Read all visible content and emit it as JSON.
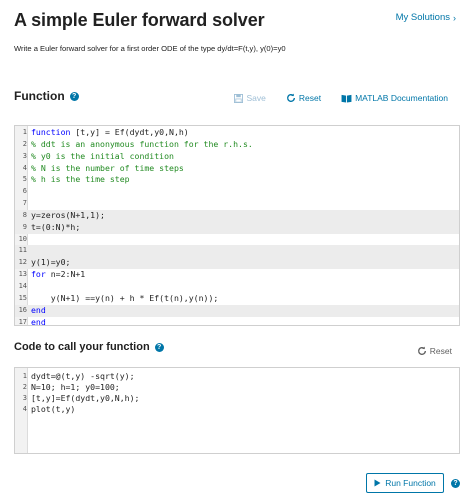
{
  "header": {
    "title": "A simple Euler forward solver",
    "my_solutions": "My Solutions",
    "description": "Write a Euler forward solver for a first order ODE of the type dy/dt=F(t,y), y(0)=y0"
  },
  "function_section": {
    "title": "Function",
    "save_label": "Save",
    "reset_label": "Reset",
    "docs_label": "MATLAB Documentation",
    "lines": [
      {
        "n": "1",
        "segments": [
          {
            "t": "function",
            "c": "kw"
          },
          {
            "t": " [t,y] = Ef(dydt,y0,N,h)",
            "c": ""
          }
        ],
        "shaded": false
      },
      {
        "n": "2",
        "segments": [
          {
            "t": "% ddt is an anonymous function for the r.h.s.",
            "c": "cm"
          }
        ],
        "shaded": false
      },
      {
        "n": "3",
        "segments": [
          {
            "t": "% y0 is the initial condition",
            "c": "cm"
          }
        ],
        "shaded": false
      },
      {
        "n": "4",
        "segments": [
          {
            "t": "% N is the number of time steps",
            "c": "cm"
          }
        ],
        "shaded": false
      },
      {
        "n": "5",
        "segments": [
          {
            "t": "% h is the time step",
            "c": "cm"
          }
        ],
        "shaded": false
      },
      {
        "n": "6",
        "segments": [],
        "shaded": false
      },
      {
        "n": "7",
        "segments": [],
        "shaded": false
      },
      {
        "n": "8",
        "segments": [
          {
            "t": "y=zeros(N+1,1);",
            "c": ""
          }
        ],
        "shaded": true
      },
      {
        "n": "9",
        "segments": [
          {
            "t": "t=(0:N)*h;",
            "c": ""
          }
        ],
        "shaded": true
      },
      {
        "n": "10",
        "segments": [],
        "shaded": false
      },
      {
        "n": "11",
        "segments": [],
        "shaded": true
      },
      {
        "n": "12",
        "segments": [
          {
            "t": "y(1)=y0;",
            "c": ""
          }
        ],
        "shaded": true
      },
      {
        "n": "13",
        "segments": [
          {
            "t": "for",
            "c": "kw"
          },
          {
            "t": " n=2:N+1",
            "c": ""
          }
        ],
        "shaded": false
      },
      {
        "n": "14",
        "segments": [],
        "shaded": false
      },
      {
        "n": "15",
        "segments": [
          {
            "t": "    y(N+1) ==y(n) + h * Ef(t(n),y(n));",
            "c": ""
          }
        ],
        "shaded": false
      },
      {
        "n": "16",
        "segments": [
          {
            "t": "end",
            "c": "kw"
          }
        ],
        "shaded": true
      },
      {
        "n": "17",
        "segments": [
          {
            "t": "end",
            "c": "kw"
          }
        ],
        "shaded": false
      }
    ]
  },
  "call_section": {
    "title": "Code to call your function",
    "reset_label": "Reset",
    "lines": [
      {
        "n": "1",
        "text": "dydt=@(t,y) -sqrt(y);"
      },
      {
        "n": "2",
        "text": "N=10; h=1; y0=100;"
      },
      {
        "n": "3",
        "text": "[t,y]=Ef(dydt,y0,N,h);"
      },
      {
        "n": "4",
        "text": "plot(t,y)"
      }
    ]
  },
  "footer": {
    "run_label": "Run Function"
  },
  "colors": {
    "accent": "#0076a8",
    "keyword": "#0000ff",
    "comment": "#228b22"
  }
}
